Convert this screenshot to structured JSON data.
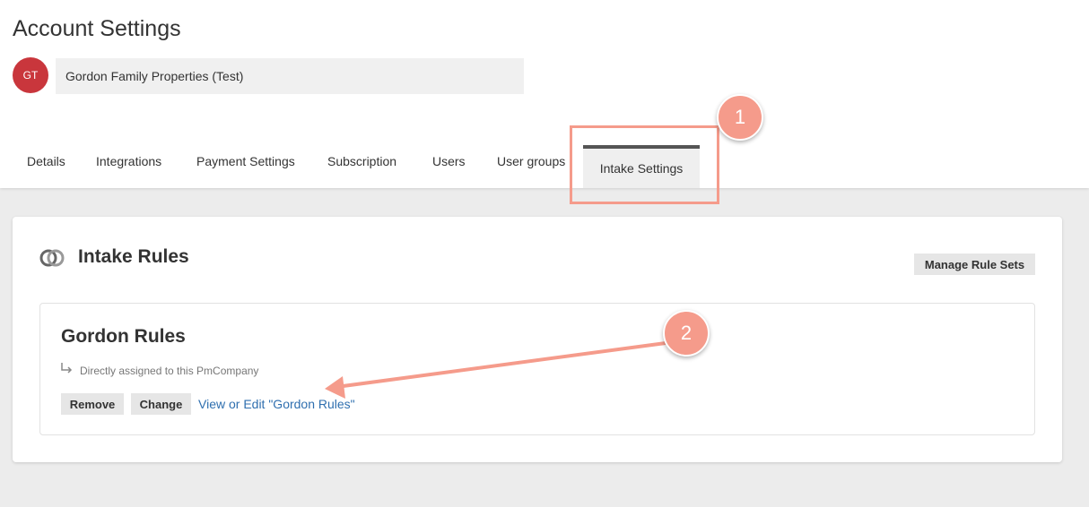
{
  "page": {
    "title": "Account Settings"
  },
  "account": {
    "avatar_initials": "GT",
    "name": "Gordon Family Properties (Test)"
  },
  "tabs": [
    {
      "label": "Details"
    },
    {
      "label": "Integrations"
    },
    {
      "label": "Payment Settings"
    },
    {
      "label": "Subscription"
    },
    {
      "label": "Users"
    },
    {
      "label": "User groups"
    },
    {
      "label": "Intake Settings",
      "active": true
    }
  ],
  "section": {
    "icon": "overlapping-circles-icon",
    "title": "Intake Rules",
    "manage_button": "Manage Rule Sets"
  },
  "ruleset": {
    "name": "Gordon Rules",
    "assignment_icon": "return-arrow-icon",
    "assignment_text": "Directly assigned to this PmCompany",
    "remove_button": "Remove",
    "change_button": "Change",
    "view_edit_link": "View or Edit \"Gordon Rules\""
  },
  "annotations": {
    "step1": "1",
    "step2": "2",
    "color": "#f59b8b"
  },
  "colors": {
    "avatar": "#c9363c",
    "link": "#2f6faf",
    "active_tab_border": "#555555"
  }
}
